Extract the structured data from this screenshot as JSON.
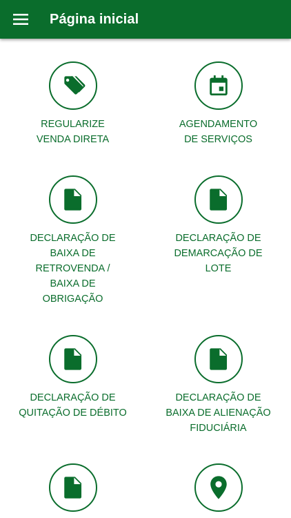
{
  "appbar": {
    "title": "Página inicial",
    "menu_icon": "hamburger-menu-icon",
    "background_color": "#0a6d2c"
  },
  "tiles": [
    {
      "icon": "tag-icon",
      "lines": [
        "REGULARIZE",
        "VENDA DIRETA"
      ]
    },
    {
      "icon": "calendar-icon",
      "lines": [
        "AGENDAMENTO",
        "DE SERVIÇOS"
      ]
    },
    {
      "icon": "document-icon",
      "lines": [
        "DECLARAÇÃO DE",
        "BAIXA DE",
        "RETROVENDA /",
        "BAIXA DE",
        "OBRIGAÇÃO"
      ]
    },
    {
      "icon": "document-icon",
      "lines": [
        "DECLARAÇÃO DE",
        "DEMARCAÇÃO DE",
        "LOTE"
      ]
    },
    {
      "icon": "document-icon",
      "lines": [
        "DECLARAÇÃO DE",
        "QUITAÇÃO DE DÉBITO"
      ]
    },
    {
      "icon": "document-icon",
      "lines": [
        "DECLARAÇÃO DE",
        "BAIXA DE ALIENAÇÃO",
        "FIDUCIÁRIA"
      ]
    },
    {
      "icon": "document-icon",
      "lines": []
    },
    {
      "icon": "location-pin-icon",
      "lines": []
    }
  ],
  "accent_color": "#0a6d2c"
}
